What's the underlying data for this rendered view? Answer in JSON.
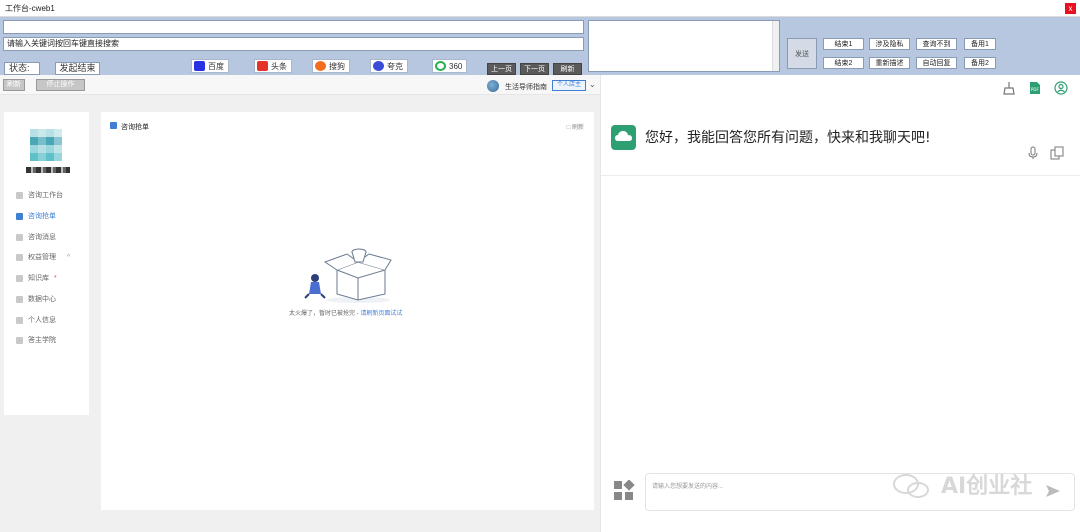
{
  "window": {
    "title": "工作台-cweb1",
    "close_glyph": "x"
  },
  "toolbar": {
    "url_value": "",
    "search_value": "请输入关键词按回车键直接搜索",
    "status_label": "状态:",
    "status_value": "发起结束",
    "engines": [
      {
        "label": "百度",
        "icon": "baidu-icon",
        "color": "#2932e1"
      },
      {
        "label": "头条",
        "icon": "toutiao-icon",
        "color": "#e4312c"
      },
      {
        "label": "搜狗",
        "icon": "sogou-icon",
        "color": "#f36d21"
      },
      {
        "label": "夸克",
        "icon": "quark-icon",
        "color": "#3a4bd8"
      },
      {
        "label": "360",
        "icon": "360-icon",
        "color": "#22b14c"
      }
    ],
    "nav": {
      "prev": "上一页",
      "next": "下一页",
      "refresh": "刷新"
    },
    "message_value": "",
    "send": "发送",
    "quick_buttons": [
      "结束1",
      "涉及隐私",
      "查询不到",
      "备用1",
      "结束2",
      "重新描述",
      "自动回复",
      "备用2"
    ]
  },
  "subbar": {
    "refresh": "刷新",
    "stop": "停止操作",
    "owner_name": "生活导师指南",
    "owner_tag": "个人店主"
  },
  "sidebar": {
    "items": [
      {
        "label": "咨询工作台",
        "active": false,
        "star": ""
      },
      {
        "label": "咨询抢单",
        "active": true,
        "star": ""
      },
      {
        "label": "咨询消息",
        "active": false,
        "star": ""
      },
      {
        "label": "权益管理",
        "active": false,
        "star": "",
        "chevron": "^"
      },
      {
        "label": "知识库",
        "active": false,
        "star": "*"
      },
      {
        "label": "数据中心",
        "active": false,
        "star": ""
      },
      {
        "label": "个人信息",
        "active": false,
        "star": ""
      },
      {
        "label": "答主学院",
        "active": false,
        "star": ""
      }
    ]
  },
  "main": {
    "header": "咨询抢单",
    "refresh": "刷新",
    "empty_text": "太火爆了，暂时已被抢完 - ",
    "empty_link": "请刷新页面试试"
  },
  "chat": {
    "greeting": "您好，我能回答您所有问题，快来和我聊天吧!",
    "input_placeholder": "请输入您想要发送的内容...",
    "watermark": "AI创业社",
    "accent": "#2e9e73"
  }
}
